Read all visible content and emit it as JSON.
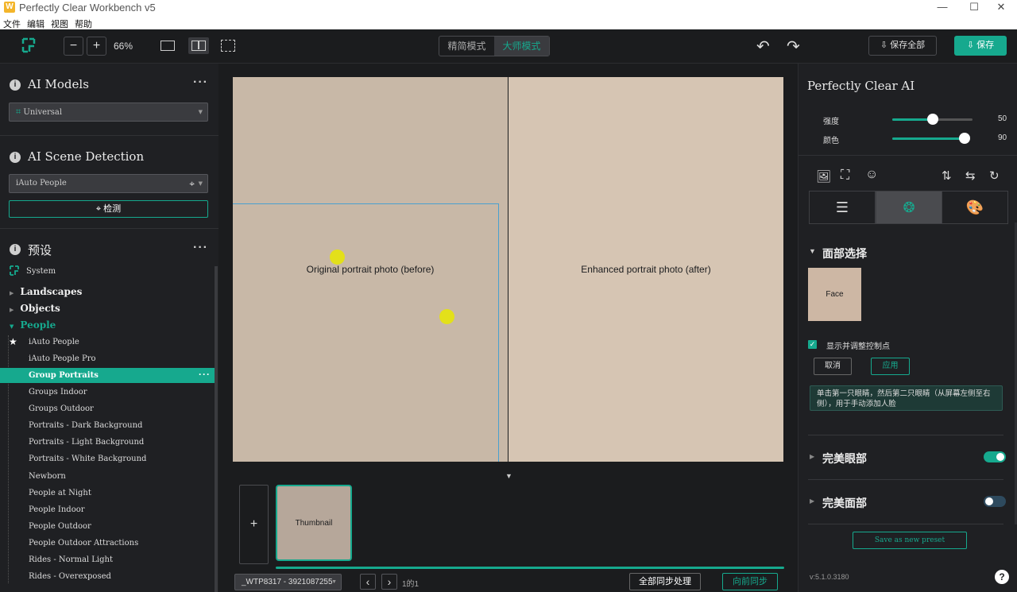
{
  "window": {
    "title": "Perfectly Clear Workbench v5",
    "icon_letter": "W"
  },
  "menu": [
    "文件",
    "编辑",
    "视图",
    "帮助"
  ],
  "toolbar": {
    "zoom": "66%",
    "mode_simple": "精简模式",
    "mode_master": "大师模式",
    "save_all": "保存全部",
    "save": "保存"
  },
  "left": {
    "ai_models_title": "AI Models",
    "model_value": "Universal",
    "scene_title": "AI Scene Detection",
    "scene_value": "iAuto People",
    "detect_label": "检测",
    "presets_title": "预设",
    "system_label": "System",
    "categories": [
      "Landscapes",
      "Objects",
      "People"
    ],
    "people_items": [
      "iAuto People",
      "iAuto People Pro",
      "Group Portraits",
      "Groups Indoor",
      "Groups Outdoor",
      "Portraits - Dark Background",
      "Portraits - Light Background",
      "Portraits - White Background",
      "Newborn",
      "People at Night",
      "People Indoor",
      "People Outdoor",
      "People Outdoor Attractions",
      "Rides - Normal Light",
      "Rides - Overexposed"
    ],
    "selected_item": "Group Portraits"
  },
  "center": {
    "filename": "_WTP8317 - 3921087255",
    "page": "1的1",
    "sync_all": "全部同步处理",
    "sync_fwd": "向前同步",
    "add": "+",
    "before_image": "Original portrait photo (before)",
    "after_image": "Enhanced portrait photo (after)",
    "thumb_image": "Thumbnail"
  },
  "right": {
    "title": "Perfectly Clear AI",
    "strength_label": "强度",
    "strength_value": "50",
    "color_label": "颜色",
    "color_value": "90",
    "face_section": "面部选择",
    "face_thumb": "Face",
    "show_ctrl": "显示并调整控制点",
    "cancel": "取消",
    "apply": "应用",
    "hint": "单击第一只眼睛，然后第二只眼睛（从屏幕左侧至右侧），用于手动添加人脸",
    "eyes_label": "完美眼部",
    "eyes_on": true,
    "face_label": "完美面部",
    "face_on": false,
    "save_preset": "Save as new preset",
    "version": "v:5.1.0.3180"
  },
  "colors": {
    "accent": "#16a98e",
    "background": "#1b1c1e"
  }
}
